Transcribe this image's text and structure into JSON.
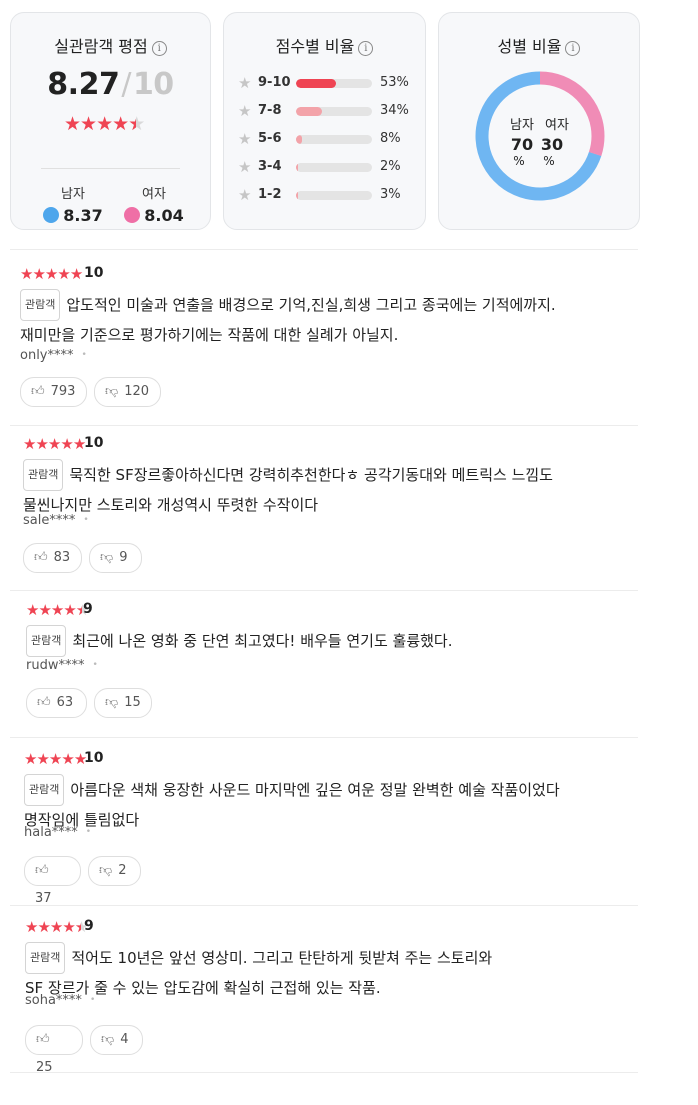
{
  "rating_card": {
    "title": "실관람객 평점",
    "info_icon": "ⓘ",
    "score": "8.27",
    "slash": "/",
    "max": "10",
    "stars": 4.5,
    "male_label": "남자",
    "male_score": "8.37",
    "female_label": "여자",
    "female_score": "8.04"
  },
  "distribution_card": {
    "title": "점수별 비율",
    "rows": [
      {
        "label": "9-10",
        "pct": "53%",
        "value": 53,
        "color": "#ef4453"
      },
      {
        "label": "7-8",
        "pct": "34%",
        "value": 34,
        "color": "#f3a3a9"
      },
      {
        "label": "5-6",
        "pct": "8%",
        "value": 8,
        "color": "#f3a3a9"
      },
      {
        "label": "3-4",
        "pct": "2%",
        "value": 2,
        "color": "#f3a3a9"
      },
      {
        "label": "1-2",
        "pct": "3%",
        "value": 3,
        "color": "#f3a3a9"
      }
    ]
  },
  "gender_card": {
    "title": "성별 비율",
    "male_label": "남자",
    "female_label": "여자",
    "male_value": "70",
    "female_value": "30",
    "unit": "%",
    "male_color": "#6fb6f2",
    "female_color": "#f08cb6"
  },
  "badge": "관람객",
  "reviews": [
    {
      "score": "10",
      "stars": 5,
      "lines": [
        "압도적인 미술과 연출을 배경으로 기억,진실,희생 그리고 종국에는 기적에까지.",
        "재미만을 기준으로 평가하기에는 작품에 대한 실례가 아닐지."
      ],
      "user": "only****",
      "likes": "793",
      "dislikes": "120"
    },
    {
      "score": "10",
      "stars": 5,
      "lines": [
        "묵직한 SF장르좋아하신다면 강력히추천한다ㅎ 공각기동대와 메트릭스 느낌도",
        "물씬나지만  스토리와 개성역시 뚜렷한 수작이다"
      ],
      "user": "sale****",
      "likes": "83",
      "dislikes": "9"
    },
    {
      "score": "9",
      "stars": 4.5,
      "lines": [
        "최근에  나온 영화 중 단연 최고였다!  배우들 연기도 훌륭했다."
      ],
      "user": "rudw****",
      "likes": "63",
      "dislikes": "15"
    },
    {
      "score": "10",
      "stars": 5,
      "lines": [
        "아름다운 색채 웅장한 사운드 마지막엔 깊은 여운 정말 완벽한 예술 작품이었다",
        "명작임에 틀림없다"
      ],
      "user": "hala****",
      "likes": "37",
      "dislikes": "2"
    },
    {
      "score": "9",
      "stars": 4.5,
      "lines": [
        "적어도 10년은 앞선 영상미. 그리고 탄탄하게 뒷받쳐 주는 스토리와",
        "SF 장르가 줄 수 있는 압도감에 확실히 근접해 있는 작품."
      ],
      "user": "soha****",
      "likes": "25",
      "dislikes": "4"
    }
  ]
}
